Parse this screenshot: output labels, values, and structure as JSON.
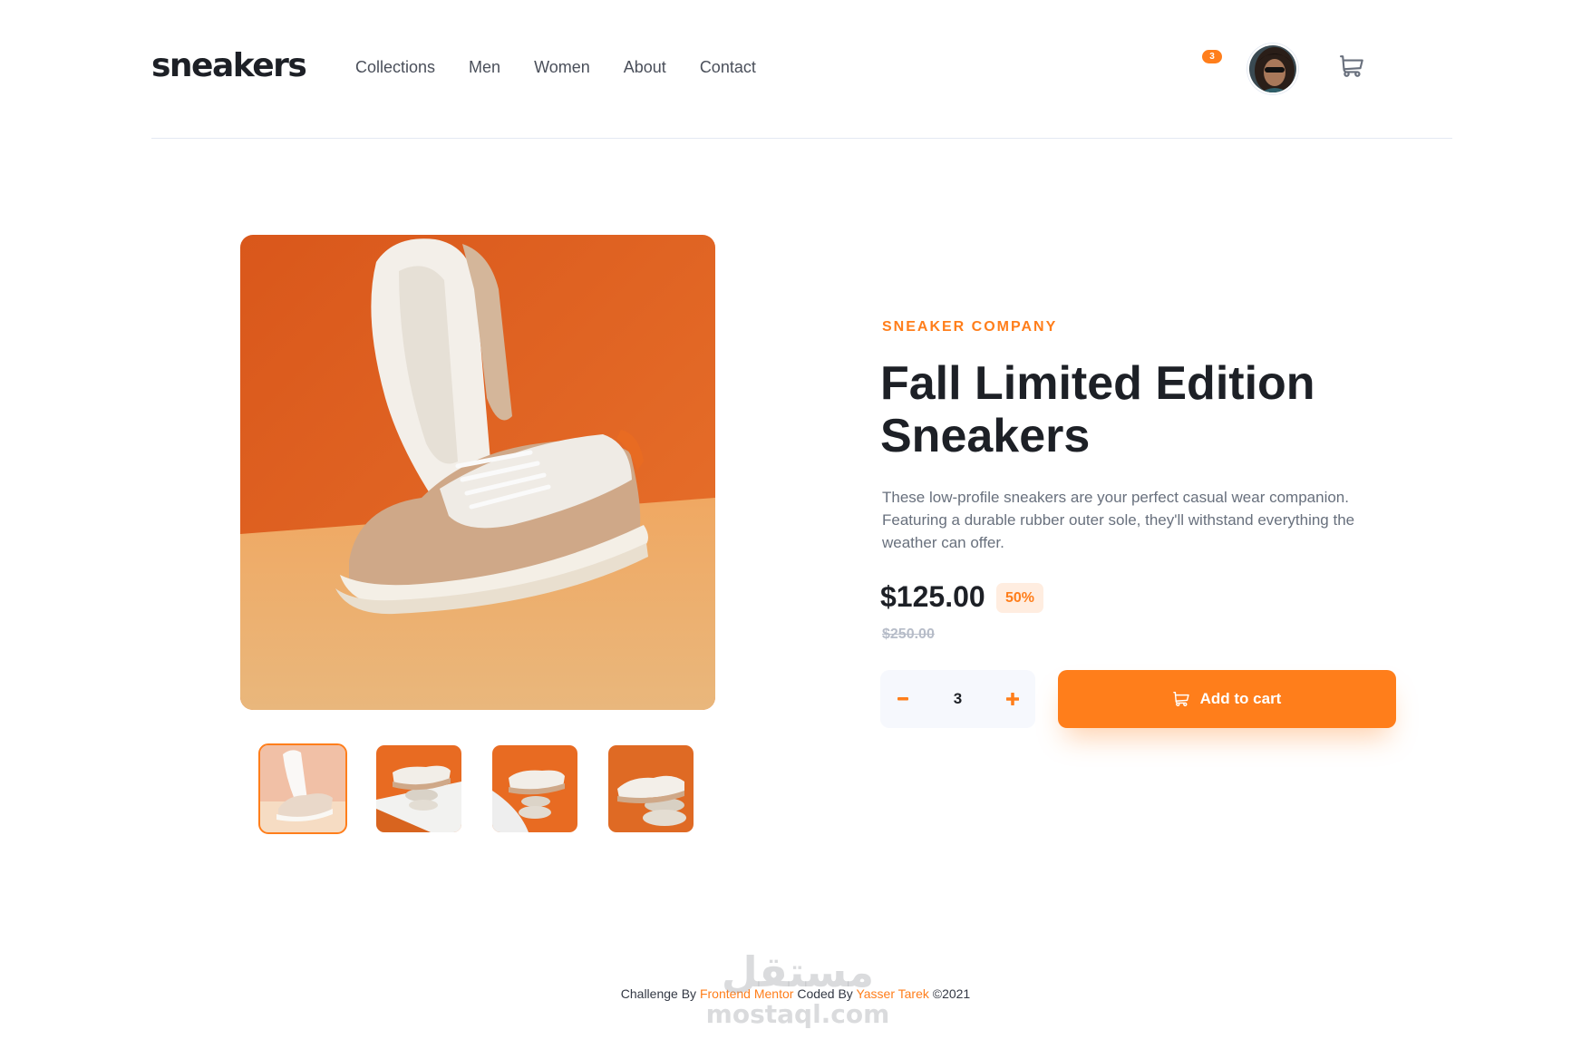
{
  "header": {
    "logo": "sneakers",
    "nav": [
      "Collections",
      "Men",
      "Women",
      "About",
      "Contact"
    ],
    "cart_count": "3",
    "cart_icon": "cart-icon",
    "avatar_icon": "avatar"
  },
  "product": {
    "company": "SNEAKER COMPANY",
    "title": "Fall Limited Edition Sneakers",
    "description": "These low-profile sneakers are your perfect casual wear companion. Featuring a durable rubber outer sole, they'll withstand everything the weather can offer.",
    "price": "$125.00",
    "discount": "50%",
    "old_price": "$250.00",
    "quantity": "3",
    "add_to_cart": "Add to cart"
  },
  "gallery": {
    "thumbnail_count": 4,
    "active_thumbnail": 1
  },
  "footer": {
    "challenge_by": "Challenge By",
    "mentor": "Frontend Mentor",
    "coded_by": "Coded By",
    "author": "Yasser Tarek",
    "copyright": "©2021"
  },
  "watermark": {
    "arabic": "مستقل",
    "domain": "mostaql.com"
  },
  "colors": {
    "accent": "#ff7e1b",
    "accent_pale": "#ffede0",
    "dark": "#1d2026",
    "gray": "#68707d"
  }
}
